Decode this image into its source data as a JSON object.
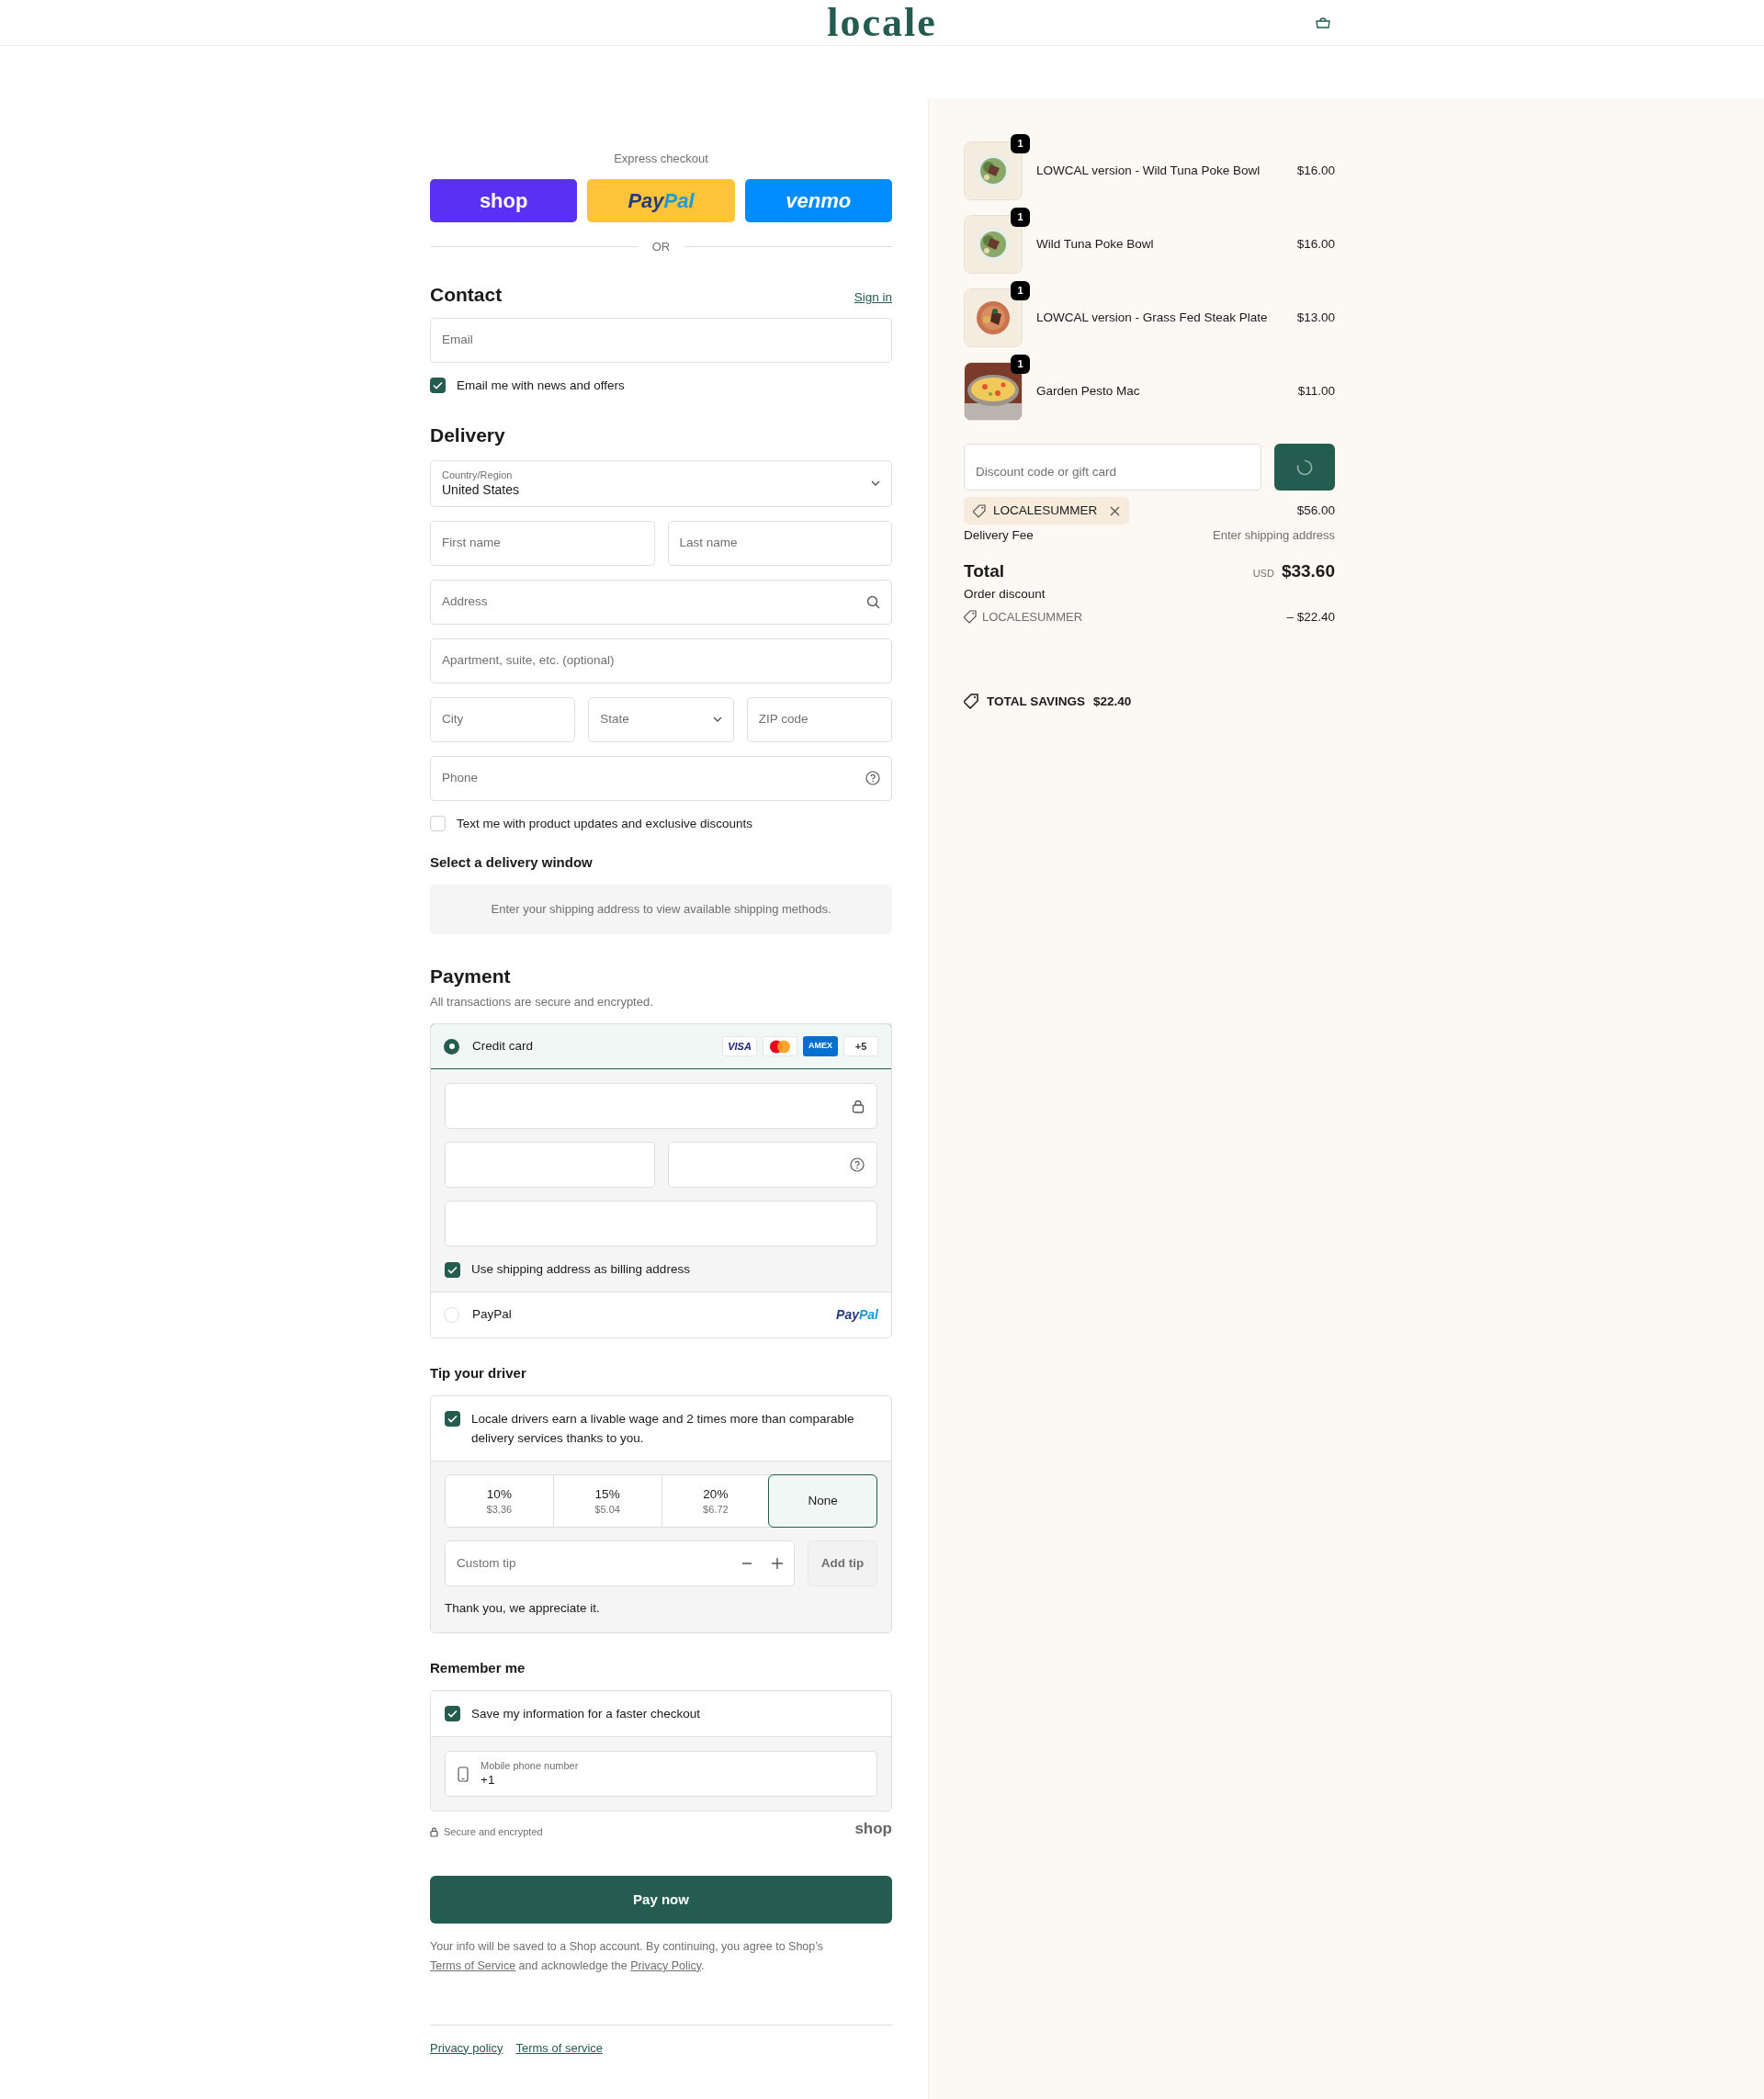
{
  "header": {
    "logo": "locale"
  },
  "express_checkout": {
    "label": "Express checkout",
    "buttons": [
      {
        "kind": "shop",
        "label": "shop"
      },
      {
        "kind": "paypal",
        "label": "PayPal"
      },
      {
        "kind": "venmo",
        "label": "venmo"
      }
    ]
  },
  "divider": "OR",
  "contact": {
    "title": "Contact",
    "sign_in": "Sign in",
    "email": {
      "placeholder": "Email"
    },
    "newsletter": {
      "label": "Email me with news and offers",
      "checked": true
    }
  },
  "delivery": {
    "title": "Delivery",
    "country": {
      "label": "Country/Region",
      "value": "United States"
    },
    "rows": [
      [
        {
          "kind": "text",
          "placeholder": "First name"
        },
        {
          "kind": "text",
          "placeholder": "Last name"
        }
      ],
      [
        {
          "kind": "search",
          "placeholder": "Address"
        }
      ],
      [
        {
          "kind": "text",
          "placeholder": "Apartment, suite, etc. (optional)"
        }
      ],
      [
        {
          "kind": "text",
          "placeholder": "City"
        },
        {
          "kind": "select",
          "placeholder": "State"
        },
        {
          "kind": "text",
          "placeholder": "ZIP code"
        }
      ],
      [
        {
          "kind": "help",
          "placeholder": "Phone"
        }
      ]
    ],
    "sms": {
      "label": "Text me with product updates and exclusive discounts",
      "checked": false
    }
  },
  "delivery_window": {
    "title": "Select a delivery window",
    "message": "Enter your shipping address to view available shipping methods."
  },
  "payment": {
    "title": "Payment",
    "subtitle": "All transactions are secure and encrypted.",
    "methods": [
      {
        "kind": "card",
        "label": "Credit card",
        "selected": true,
        "brands": [
          {
            "kind": "visa",
            "label": "VISA"
          },
          {
            "kind": "mastercard"
          },
          {
            "kind": "amex",
            "label": "AMEX"
          },
          {
            "kind": "more",
            "label": "+5"
          }
        ]
      },
      {
        "kind": "paypal",
        "label": "PayPal",
        "selected": false,
        "logo": "PayPal"
      }
    ],
    "billing": {
      "label": "Use shipping address as billing address",
      "checked": true
    }
  },
  "tip": {
    "title": "Tip your driver",
    "note": {
      "label": "Locale drivers earn a livable wage and 2 times more than comparable delivery services thanks to you.",
      "checked": true
    },
    "options": [
      {
        "percent": "10%",
        "amount": "$3.36",
        "selected": false
      },
      {
        "percent": "15%",
        "amount": "$5.04",
        "selected": false
      },
      {
        "percent": "20%",
        "amount": "$6.72",
        "selected": false
      },
      {
        "percent": "None",
        "selected": true
      }
    ],
    "custom": {
      "placeholder": "Custom tip"
    },
    "add_button": "Add tip",
    "thanks": "Thank you, we appreciate it."
  },
  "remember": {
    "title": "Remember me",
    "save": {
      "label": "Save my information for a faster checkout",
      "checked": true
    },
    "phone": {
      "label": "Mobile phone number",
      "value": "+1"
    }
  },
  "secure": "Secure and encrypted",
  "shop_logo": "shop",
  "pay_button": "Pay now",
  "disclaimer": [
    {
      "text": "Your info will be saved to a Shop account. By continuing, you agree to Shop’s "
    },
    {
      "link": "Terms of Service"
    },
    {
      "text": " and acknowledge the "
    },
    {
      "link": "Privacy Policy"
    },
    {
      "text": "."
    }
  ],
  "footer_links": [
    "Privacy policy",
    "Terms of service"
  ],
  "summary": {
    "items": [
      {
        "name": "LOWCAL version - Wild Tuna Poke Bowl",
        "price": "$16.00",
        "quantity": "1",
        "kind": "bowl"
      },
      {
        "name": "Wild Tuna Poke Bowl",
        "price": "$16.00",
        "quantity": "1",
        "kind": "bowl"
      },
      {
        "name": "LOWCAL version - Grass Fed Steak Plate",
        "price": "$13.00",
        "quantity": "1",
        "kind": "plate"
      },
      {
        "name": "Garden Pesto Mac",
        "price": "$11.00",
        "quantity": "1",
        "kind": "pasta"
      }
    ],
    "discount": {
      "placeholder": "Discount code or gift card"
    },
    "applied_code": "LOCALESUMMER",
    "subtotal": "$56.00",
    "delivery_fee": {
      "label": "Delivery Fee",
      "value": "Enter shipping address"
    },
    "total": {
      "label": "Total",
      "currency": "USD",
      "value": "$33.60"
    },
    "order_discount": {
      "label": "Order discount",
      "code": "LOCALESUMMER",
      "amount": "– $22.40"
    },
    "savings": {
      "label": "TOTAL SAVINGS",
      "value": "$22.40"
    }
  }
}
